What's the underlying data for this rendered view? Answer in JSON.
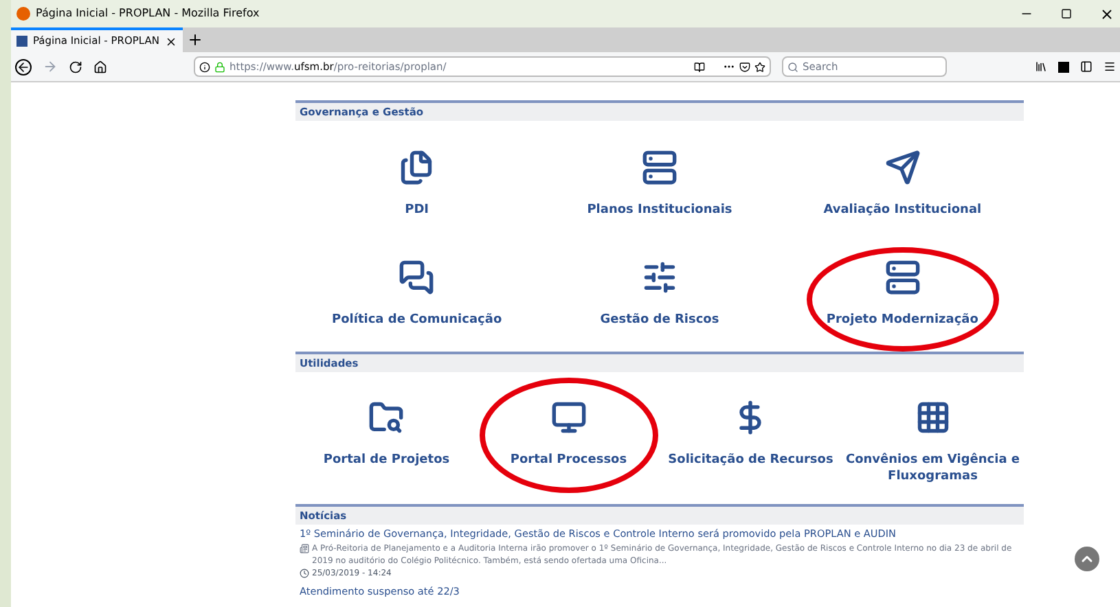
{
  "window": {
    "title": "Página Inicial - PROPLAN - Mozilla Firefox"
  },
  "tabs": [
    {
      "label": "Página Inicial - PROPLAN",
      "selected": true
    }
  ],
  "address": {
    "prefix": "https://www.",
    "domain": "ufsm.br",
    "path": "/pro-reitorias/proplan/"
  },
  "search": {
    "placeholder": "Search"
  },
  "sections": [
    {
      "title": "Governança e Gestão",
      "items": [
        {
          "label": "PDI",
          "circled": false
        },
        {
          "label": "Planos Institucionais",
          "circled": false
        },
        {
          "label": "Avaliação Institucional",
          "circled": false
        },
        {
          "label": "Política de Comunicação",
          "circled": false
        },
        {
          "label": "Gestão de Riscos",
          "circled": false
        },
        {
          "label": "Projeto Modernização",
          "circled": true
        }
      ]
    },
    {
      "title": "Utilidades",
      "items": [
        {
          "label": "Portal de Projetos",
          "circled": false
        },
        {
          "label": "Portal Processos",
          "circled": true
        },
        {
          "label": "Solicitação de Recursos",
          "circled": false
        },
        {
          "label": "Convênios em Vigência e Fluxogramas",
          "circled": false
        }
      ]
    }
  ],
  "news": {
    "title": "Notícias",
    "items": [
      {
        "headline": "1º Seminário de Governança, Integridade, Gestão de Riscos e Controle Interno será promovido pela PROPLAN e AUDIN",
        "summary": "A Pró-Reitoria de Planejamento e a Auditoria Interna irão promover o 1º Seminário de Governança, Integridade, Gestão de Riscos e Controle Interno no dia 23 de abril de 2019 no auditório do Colégio Politécnico. Também, está sendo ofertada uma Oficina...",
        "date": "25/03/2019 - 14:24"
      },
      {
        "headline": "Atendimento suspenso até 22/3"
      }
    ]
  }
}
